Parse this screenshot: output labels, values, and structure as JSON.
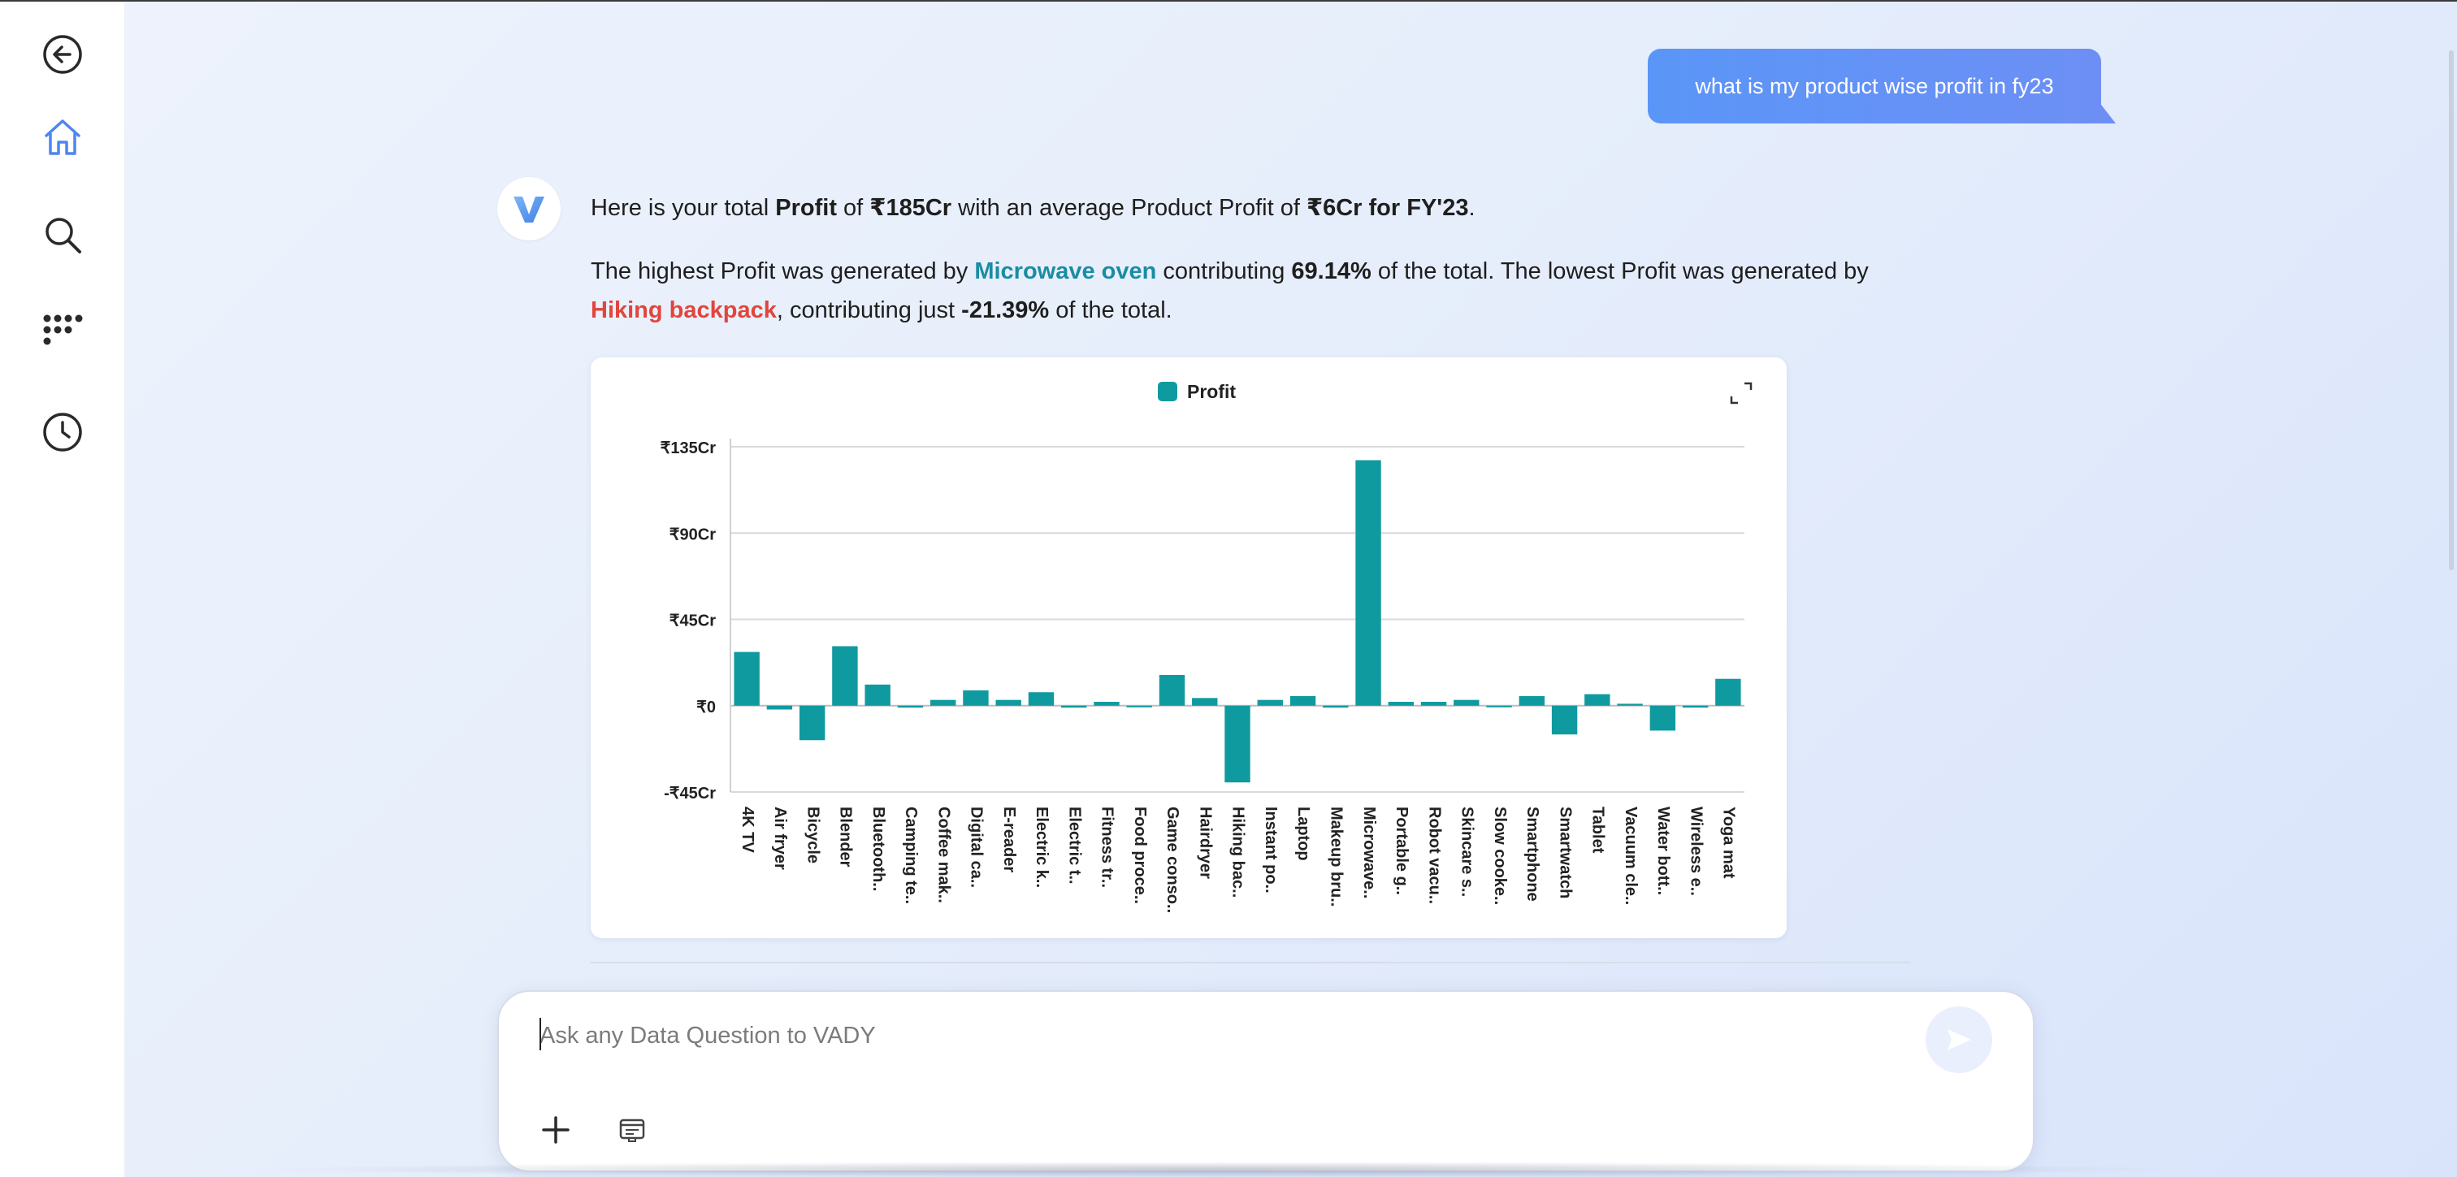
{
  "sidebar": {
    "items": [
      {
        "icon": "back-arrow-icon"
      },
      {
        "icon": "home-icon",
        "active": true
      },
      {
        "icon": "search-icon"
      },
      {
        "icon": "apps-grid-icon"
      },
      {
        "icon": "history-clock-icon"
      }
    ]
  },
  "user_message": "what is my product wise profit in fy23",
  "answer": {
    "p1_pre": "Here is your total ",
    "p1_b1": "Profit",
    "p1_mid1": " of ",
    "p1_b2": "₹185Cr",
    "p1_mid2": " with an average Product Profit of ",
    "p1_b3": "₹6Cr for FY'23",
    "p1_end": ".",
    "p2_pre": "The highest Profit was generated by ",
    "p2_top": "Microwave oven",
    "p2_mid1": " contributing ",
    "p2_b1": "69.14%",
    "p2_mid2": " of the total. The lowest Profit was generated by ",
    "p2_low": "Hiking backpack",
    "p2_mid3": ", contributing just ",
    "p2_b2": "-21.39%",
    "p2_end": " of the total."
  },
  "input": {
    "placeholder": "Ask any Data Question to VADY"
  },
  "colors": {
    "accent": "#5a96f7",
    "bar": "#0f9aa0",
    "highlight_top": "#1b8ca3",
    "highlight_low": "#e2453c"
  },
  "chart_data": {
    "type": "bar",
    "legend": "top-center",
    "grid": true,
    "series": [
      {
        "name": "Profit",
        "values": [
          28,
          -2,
          -18,
          31,
          11,
          -1,
          3,
          8,
          3,
          7,
          -1,
          2,
          0,
          16,
          4,
          -40,
          3,
          5,
          -1,
          128,
          2,
          2,
          3,
          0,
          5,
          -15,
          6,
          1,
          -13,
          -1,
          14
        ]
      }
    ],
    "categories": [
      "4K TV",
      "Air fryer",
      "Bicycle",
      "Blender",
      "Bluetooth..",
      "Camping te..",
      "Coffee mak..",
      "Digital ca..",
      "E-reader",
      "Electric k..",
      "Electric t..",
      "Fitness tr..",
      "Food proce..",
      "Game conso..",
      "Hairdryer",
      "Hiking bac..",
      "Instant po..",
      "Laptop",
      "Makeup bru..",
      "Microwave..",
      "Portable g..",
      "Robot vacu..",
      "Skincare s..",
      "Slow cooke..",
      "Smartphone",
      "Smartwatch",
      "Tablet",
      "Vacuum cle..",
      "Water bott..",
      "Wireless e..",
      "Yoga mat"
    ],
    "y_ticks": [
      {
        "value": 135,
        "label": "₹135Cr"
      },
      {
        "value": 90,
        "label": "₹90Cr"
      },
      {
        "value": 45,
        "label": "₹45Cr"
      },
      {
        "value": 0,
        "label": "₹0"
      },
      {
        "value": -45,
        "label": "-₹45Cr"
      }
    ],
    "ylim": [
      -45,
      135
    ]
  }
}
